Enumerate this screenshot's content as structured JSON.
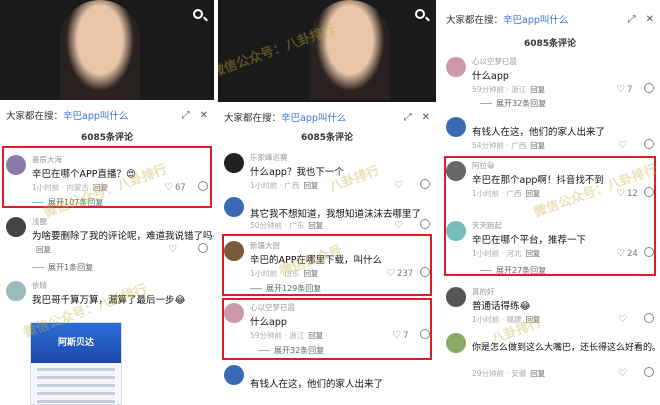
{
  "panels": [
    {
      "suggest_prefix": "大家都在搜：",
      "suggest_link": "辛巴app叫什么",
      "comment_count": "6085条评论",
      "comments": [
        {
          "user": "晏辰大海",
          "text": "辛巴在哪个APP直播？😍",
          "meta": "1小时前 · 内蒙古",
          "reply": "回复",
          "likes": "67",
          "expand": "展开107条回复"
        },
        {
          "user": "浅醒",
          "text": "为啥要删除了我的评论呢，难道我说错了吗😂",
          "meta": "",
          "reply": "回复",
          "likes": "",
          "expand": "展开1条回复"
        },
        {
          "user": "依晴",
          "text": "我巴哥千算万算，漏算了最后一步😂",
          "meta": "",
          "reply": "",
          "likes": "",
          "expand": ""
        }
      ],
      "thumb_title": "阿斯贝达"
    },
    {
      "suggest_prefix": "大家都在搜：",
      "suggest_link": "辛巴app叫什么",
      "comment_count": "6085条评论",
      "comments": [
        {
          "user": "乐家峰巡赛",
          "text": "什么app？我也下一个",
          "meta": "1小时前 · 广西",
          "reply": "回复",
          "likes": "",
          "expand": ""
        },
        {
          "user": "",
          "text": "其它我不想知道，我想知道沫沫去哪里了",
          "meta": "50分钟前 · 广东",
          "reply": "回复",
          "likes": "",
          "expand": ""
        },
        {
          "user": "新疆大厨",
          "text": "辛巴的APP在哪里下载，叫什么",
          "meta": "1小时前 · 山东",
          "reply": "回复",
          "likes": "237",
          "expand": "展开129条回复"
        },
        {
          "user": "心以空梦已晨",
          "text": "什么app",
          "meta": "59分钟前 · 浙江",
          "reply": "回复",
          "likes": "7",
          "expand": "展开32条回复"
        },
        {
          "user": "",
          "text": "有钱人在这，他们的家人出来了",
          "meta": "",
          "reply": "",
          "likes": "",
          "expand": ""
        }
      ]
    },
    {
      "suggest_prefix": "大家都在搜：",
      "suggest_link": "辛巴app叫什么",
      "comment_count": "6085条评论",
      "comments": [
        {
          "user": "心以空梦已晨",
          "text": "什么app",
          "meta": "59分钟前 · 浙江",
          "reply": "回复",
          "likes": "7",
          "expand": "展开32条回复"
        },
        {
          "user": "",
          "text": "有钱人在这，他们的家人出来了",
          "meta": "54分钟前 · 广西",
          "reply": "回复",
          "likes": "",
          "expand": ""
        },
        {
          "user": "阿拉😀",
          "text": "辛巴在那个app啊！抖音找不到",
          "meta": "1小时前 · 广西",
          "reply": "回复",
          "likes": "12",
          "expand": ""
        },
        {
          "user": "天天跑起",
          "text": "辛巴在哪个平台，推荐一下",
          "meta": "1小时前 · 河北",
          "reply": "回复",
          "likes": "24",
          "expand": "展开27条回复"
        },
        {
          "user": "真的好",
          "text": "普通话得练😂",
          "meta": "1小时前 · 福建",
          "reply": "回复",
          "likes": "",
          "expand": ""
        },
        {
          "user": "",
          "text": "你是怎么做到这么大嘴巴，还长得这么好看的。😂😂😂",
          "meta": "29分钟前 · 安徽",
          "reply": "回复",
          "likes": "",
          "expand": ""
        }
      ]
    }
  ],
  "watermark": [
    "微信公众号：八卦排行",
    "八卦排行",
    "微信公众号"
  ],
  "accent": "#d9202a",
  "link_color": "#3d6ed7"
}
